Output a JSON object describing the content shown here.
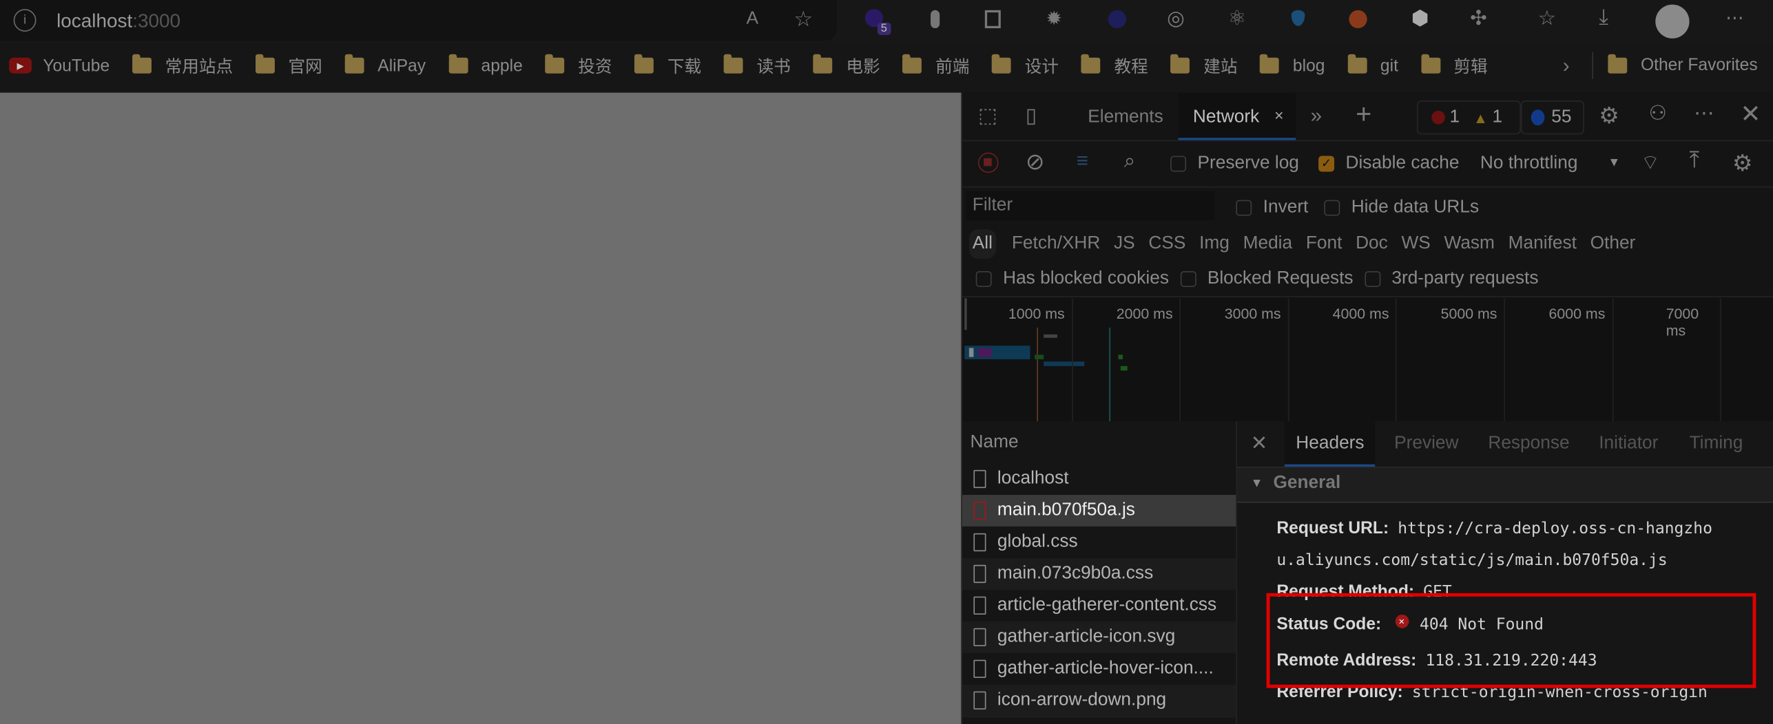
{
  "browser": {
    "url_host": "localhost",
    "url_port": ":3000",
    "address_icons": [
      "info-icon",
      "read-aloud-icon",
      "add-favorite-icon"
    ],
    "extension_icons": [
      "extension-purple-icon",
      "extension-toggle-icon",
      "extension-square-icon",
      "extension-gear-icon",
      "extension-moon-icon",
      "extension-target-icon",
      "extension-react-icon",
      "extension-gem-icon",
      "extension-lifebuoy-icon",
      "extension-hexagon-icon",
      "extensions-puzzle-icon",
      "favorites-icon",
      "downloads-icon",
      "profile-avatar",
      "more-icon"
    ],
    "extension_badge": "5"
  },
  "bookmarks": {
    "items": [
      "YouTube",
      "常用站点",
      "官网",
      "AliPay",
      "apple",
      "投资",
      "下载",
      "读书",
      "电影",
      "前端",
      "设计",
      "教程",
      "建站",
      "blog",
      "git",
      "剪辑"
    ],
    "other": "Other Favorites"
  },
  "devtools": {
    "tabs": [
      "Elements",
      "Network"
    ],
    "active_tab": "Network",
    "errors": "1",
    "warnings": "1",
    "messages": "55",
    "toolbar": {
      "preserve_log": "Preserve log",
      "preserve_log_checked": false,
      "disable_cache": "Disable cache",
      "disable_cache_checked": true,
      "throttling": "No throttling"
    },
    "filter_placeholder": "Filter",
    "invert": "Invert",
    "hide_data_urls": "Hide data URLs",
    "type_filters": [
      "All",
      "Fetch/XHR",
      "JS",
      "CSS",
      "Img",
      "Media",
      "Font",
      "Doc",
      "WS",
      "Wasm",
      "Manifest",
      "Other"
    ],
    "active_type": "All",
    "extra_filters": [
      "Has blocked cookies",
      "Blocked Requests",
      "3rd-party requests"
    ],
    "timeline_ticks": [
      "1000 ms",
      "2000 ms",
      "3000 ms",
      "4000 ms",
      "5000 ms",
      "6000 ms",
      "7000 ms"
    ],
    "name_header": "Name",
    "requests": [
      {
        "name": "localhost",
        "type": "doc"
      },
      {
        "name": "main.b070f50a.js",
        "type": "error",
        "selected": true
      },
      {
        "name": "global.css",
        "type": "css"
      },
      {
        "name": "main.073c9b0a.css",
        "type": "css"
      },
      {
        "name": "article-gatherer-content.css",
        "type": "css"
      },
      {
        "name": "gather-article-icon.svg",
        "type": "img"
      },
      {
        "name": "gather-article-hover-icon....",
        "type": "img"
      },
      {
        "name": "icon-arrow-down.png",
        "type": "img"
      }
    ],
    "detail_tabs": [
      "Headers",
      "Preview",
      "Response",
      "Initiator",
      "Timing"
    ],
    "active_detail_tab": "Headers",
    "general": {
      "title": "General",
      "request_url_label": "Request URL:",
      "request_url_line1": "https://cra-deploy.oss-cn-hangzho",
      "request_url_line2": "u.aliyuncs.com/static/js/main.b070f50a.js",
      "request_method_label": "Request Method:",
      "request_method": "GET",
      "status_code_label": "Status Code:",
      "status_code": "404 Not Found",
      "remote_address_label": "Remote Address:",
      "remote_address": "118.31.219.220:443",
      "referrer_policy_label": "Referrer Policy:",
      "referrer_policy": "strict-origin-when-cross-origin"
    },
    "highlight_color": "#e00000"
  }
}
